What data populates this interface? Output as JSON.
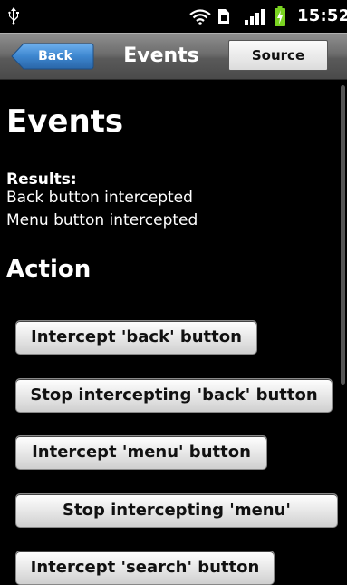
{
  "status_bar": {
    "time": "15:52",
    "icons": [
      "usb-icon",
      "wifi-icon",
      "sim-icon",
      "signal-icon",
      "battery-charging-icon"
    ]
  },
  "title_bar": {
    "back_label": "Back",
    "title": "Events",
    "source_label": "Source"
  },
  "content": {
    "heading": "Events",
    "results_label": "Results:",
    "results": [
      "Back button intercepted",
      "Menu button intercepted"
    ],
    "action_heading": "Action",
    "buttons": [
      "Intercept 'back' button",
      "Stop intercepting 'back' button",
      "Intercept 'menu' button",
      "Stop intercepting 'menu'",
      "Intercept 'search' button"
    ]
  },
  "colors": {
    "background": "#000000",
    "title_bar": "#6d6d6d",
    "back_button": "#3a7fc4",
    "battery": "#7ad321"
  }
}
